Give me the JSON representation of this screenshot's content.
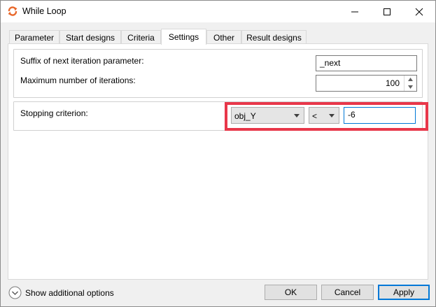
{
  "window": {
    "title": "While Loop",
    "icon": "loop-icon",
    "accent": "#e8672a"
  },
  "tabs": [
    {
      "label": "Parameter",
      "active": false
    },
    {
      "label": "Start designs",
      "active": false
    },
    {
      "label": "Criteria",
      "active": false
    },
    {
      "label": "Settings",
      "active": true
    },
    {
      "label": "Other",
      "active": false
    },
    {
      "label": "Result designs",
      "active": false
    }
  ],
  "settings": {
    "suffix_label": "Suffix of next iteration parameter:",
    "suffix_value": "_next",
    "max_iter_label": "Maximum number of iterations:",
    "max_iter_value": "100",
    "stopping_label": "Stopping criterion:",
    "criterion_variable": "obj_Y",
    "criterion_operator": "<",
    "criterion_value": "-6"
  },
  "highlight_color": "#e8374a",
  "footer": {
    "show_options_label": "Show additional options",
    "ok_label": "OK",
    "cancel_label": "Cancel",
    "apply_label": "Apply"
  }
}
